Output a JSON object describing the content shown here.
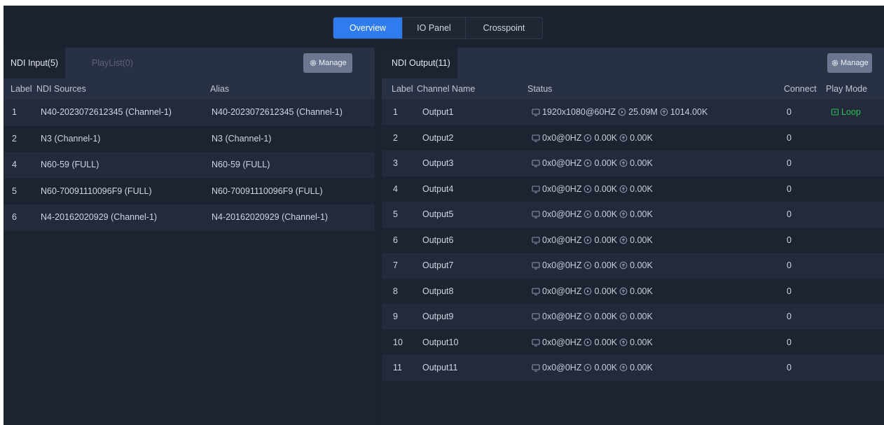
{
  "tabs": [
    {
      "label": "Overview",
      "active": true
    },
    {
      "label": "IO Panel",
      "active": false
    },
    {
      "label": "Crosspoint",
      "active": false
    }
  ],
  "input_panel": {
    "tab_active": "NDI Input(5)",
    "tab_inactive": "PlayList(0)",
    "manage_label": "Manage",
    "columns": {
      "label": "Label",
      "source": "NDI Sources",
      "alias": "Alias"
    },
    "rows": [
      {
        "label": "1",
        "source": "N40-2023072612345 (Channel-1)",
        "alias": "N40-2023072612345 (Channel-1)"
      },
      {
        "label": "2",
        "source": "N3 (Channel-1)",
        "alias": "N3 (Channel-1)"
      },
      {
        "label": "4",
        "source": "N60-59 (FULL)",
        "alias": "N60-59 (FULL)"
      },
      {
        "label": "5",
        "source": "N60-70091110096F9 (FULL)",
        "alias": "N60-70091110096F9 (FULL)"
      },
      {
        "label": "6",
        "source": "N4-20162020929 (Channel-1)",
        "alias": "N4-20162020929 (Channel-1)"
      }
    ]
  },
  "output_panel": {
    "tab_active": "NDI Output(11)",
    "manage_label": "Manage",
    "columns": {
      "label": "Label",
      "channel": "Channel Name",
      "status": "Status",
      "connect": "Connect",
      "play_mode": "Play Mode"
    },
    "rows": [
      {
        "label": "1",
        "channel": "Output1",
        "resolution": "1920x1080@60HZ",
        "bitrate_in": "25.09M",
        "bitrate_out": "1014.00K",
        "connect": "0",
        "play_mode": "Loop"
      },
      {
        "label": "2",
        "channel": "Output2",
        "resolution": "0x0@0HZ",
        "bitrate_in": "0.00K",
        "bitrate_out": "0.00K",
        "connect": "0",
        "play_mode": ""
      },
      {
        "label": "3",
        "channel": "Output3",
        "resolution": "0x0@0HZ",
        "bitrate_in": "0.00K",
        "bitrate_out": "0.00K",
        "connect": "0",
        "play_mode": ""
      },
      {
        "label": "4",
        "channel": "Output4",
        "resolution": "0x0@0HZ",
        "bitrate_in": "0.00K",
        "bitrate_out": "0.00K",
        "connect": "0",
        "play_mode": ""
      },
      {
        "label": "5",
        "channel": "Output5",
        "resolution": "0x0@0HZ",
        "bitrate_in": "0.00K",
        "bitrate_out": "0.00K",
        "connect": "0",
        "play_mode": ""
      },
      {
        "label": "6",
        "channel": "Output6",
        "resolution": "0x0@0HZ",
        "bitrate_in": "0.00K",
        "bitrate_out": "0.00K",
        "connect": "0",
        "play_mode": ""
      },
      {
        "label": "7",
        "channel": "Output7",
        "resolution": "0x0@0HZ",
        "bitrate_in": "0.00K",
        "bitrate_out": "0.00K",
        "connect": "0",
        "play_mode": ""
      },
      {
        "label": "8",
        "channel": "Output8",
        "resolution": "0x0@0HZ",
        "bitrate_in": "0.00K",
        "bitrate_out": "0.00K",
        "connect": "0",
        "play_mode": ""
      },
      {
        "label": "9",
        "channel": "Output9",
        "resolution": "0x0@0HZ",
        "bitrate_in": "0.00K",
        "bitrate_out": "0.00K",
        "connect": "0",
        "play_mode": ""
      },
      {
        "label": "10",
        "channel": "Output10",
        "resolution": "0x0@0HZ",
        "bitrate_in": "0.00K",
        "bitrate_out": "0.00K",
        "connect": "0",
        "play_mode": ""
      },
      {
        "label": "11",
        "channel": "Output11",
        "resolution": "0x0@0HZ",
        "bitrate_in": "0.00K",
        "bitrate_out": "0.00K",
        "connect": "0",
        "play_mode": ""
      }
    ]
  },
  "colors": {
    "accent": "#2f7bf0",
    "loop_green": "#2dbd5a",
    "background": "#1c2230"
  },
  "icons": {
    "manage": "gear-icon",
    "resolution": "monitor-icon",
    "bitrate_in": "play-circle-icon",
    "bitrate_out": "upload-circle-icon",
    "play_mode": "loop-icon"
  }
}
